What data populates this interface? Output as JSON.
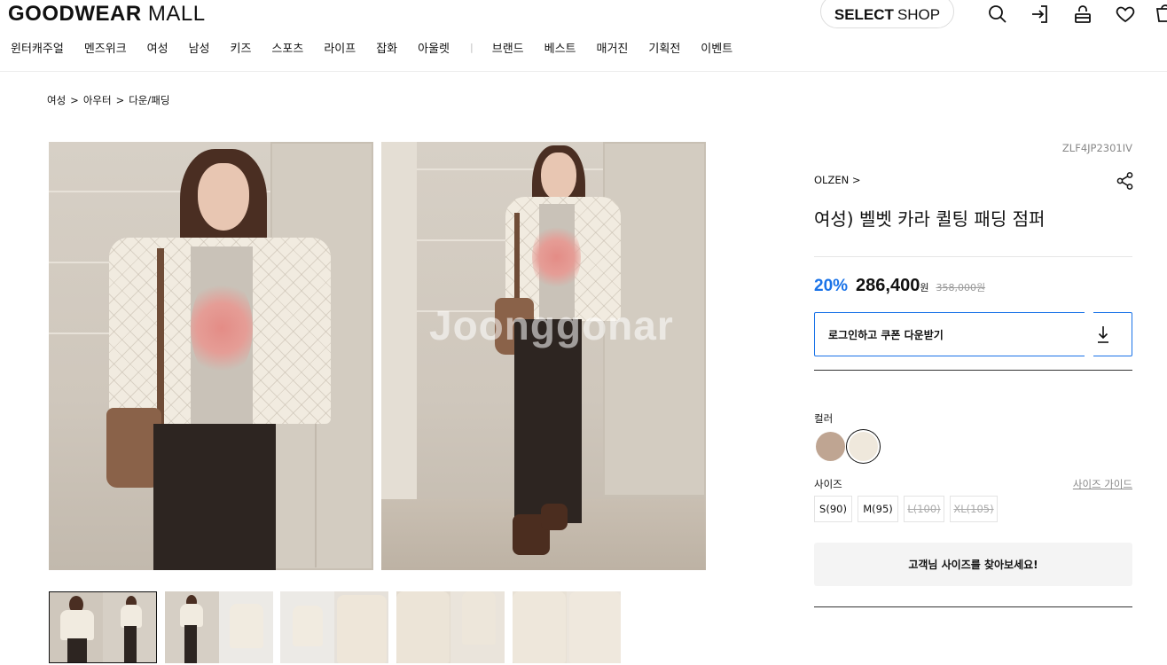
{
  "header": {
    "logo_bold": "GOODWEAR",
    "logo_light": "MALL",
    "select_shop_bold": "SELECT",
    "select_shop_light": "SHOP",
    "icons": [
      "search-icon",
      "login-icon",
      "shopping-bag-icon",
      "heart-icon",
      "cart-icon"
    ]
  },
  "nav": {
    "items": [
      "윈터캐주얼",
      "멘즈위크",
      "여성",
      "남성",
      "키즈",
      "스포츠",
      "라이프",
      "잡화",
      "아울렛"
    ],
    "separator": "|",
    "items2": [
      "브랜드",
      "베스트",
      "매거진",
      "기획전",
      "이벤트"
    ]
  },
  "breadcrumb": [
    "여성",
    "아우터",
    "다운/패딩"
  ],
  "breadcrumb_sep": ">",
  "watermark": "Joonggonar",
  "product": {
    "sku": "ZLF4JP2301IV",
    "brand": "OLZEN >",
    "title": "여성) 벨벳 카라 퀼팅 패딩 점퍼",
    "discount": "20%",
    "price": "286,400",
    "currency": "원",
    "original_price": "358,000원",
    "coupon_label": "로그인하고 쿠폰 다운받기",
    "color_label": "컬러",
    "colors": [
      {
        "name": "brown",
        "hex": "#bfa592"
      },
      {
        "name": "ivory",
        "hex": "#efe8dc",
        "selected": true
      }
    ],
    "size_label": "사이즈",
    "size_guide": "사이즈 가이드",
    "sizes": [
      {
        "label": "S(90)",
        "available": true
      },
      {
        "label": "M(95)",
        "available": true
      },
      {
        "label": "L(100)",
        "available": false
      },
      {
        "label": "XL(105)",
        "available": false
      }
    ],
    "find_size": "고객님 사이즈를 찾아보세요!"
  },
  "colors": {
    "accent": "#1a73e8",
    "text": "#111111",
    "muted": "#888888"
  }
}
